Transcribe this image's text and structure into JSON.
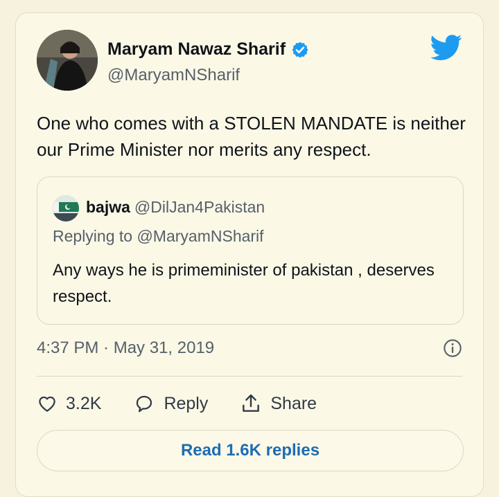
{
  "tweet": {
    "author_name": "Maryam Nawaz Sharif",
    "author_handle": "@MaryamNSharif",
    "text": "One who comes with a STOLEN MANDATE is neither our Prime Minister nor merits any respect.",
    "timestamp": "4:37 PM · May 31, 2019",
    "likes": "3.2K",
    "reply_label": "Reply",
    "share_label": "Share",
    "read_replies_label": "Read 1.6K replies"
  },
  "quoted": {
    "name": "bajwa",
    "handle": "@DilJan4Pakistan",
    "replying_to": "Replying to @MaryamNSharif",
    "text": "Any ways he is primeminister of pakistan , deserves respect."
  },
  "icons": {
    "verified": "verified-badge-icon",
    "brand": "twitter-bird-icon",
    "info": "info-icon",
    "like": "heart-icon",
    "reply": "speech-bubble-icon",
    "share": "share-upload-icon"
  },
  "colors": {
    "background": "#f7f2dd",
    "accent": "#1d9bf0",
    "link": "#1d6cb3",
    "secondary_text": "#55606a"
  }
}
